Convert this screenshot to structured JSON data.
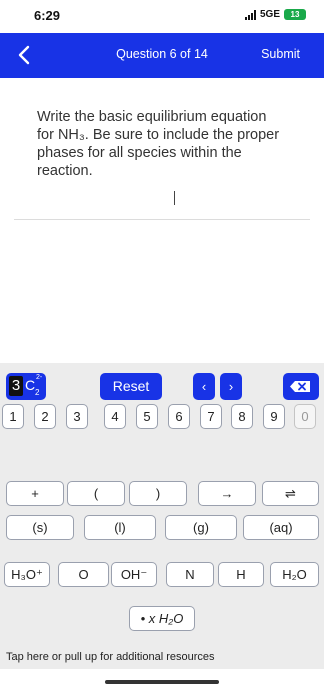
{
  "status_bar": {
    "time": "6:29",
    "network": "5GE",
    "battery": "13"
  },
  "nav": {
    "back_icon": "chevron-left-icon",
    "title": "Question 6 of 14",
    "submit_label": "Submit"
  },
  "question": {
    "text": "Write the basic equilibrium equation for NH₃. Be sure to include the proper phases for all species within the reaction."
  },
  "keypad": {
    "formula_digit": "3",
    "formula_element": "C",
    "formula_subscript": "2",
    "formula_charge": "2-",
    "reset_label": "Reset",
    "left_arrow": "‹",
    "right_arrow": "›",
    "backspace_icon": "backspace-icon",
    "digits": [
      "1",
      "2",
      "3",
      "4",
      "5",
      "6",
      "7",
      "8",
      "9",
      "0"
    ],
    "operators": [
      "+",
      "(",
      ")",
      "→",
      "⇌"
    ],
    "phases": [
      "(s)",
      "(l)",
      "(g)",
      "(aq)"
    ],
    "species": [
      "H₃O⁺",
      "O",
      "OH⁻",
      "N",
      "H",
      "H₂O"
    ],
    "hydrate": "• x H₂O"
  },
  "footer": {
    "text": "Tap here or pull up for additional resources"
  }
}
